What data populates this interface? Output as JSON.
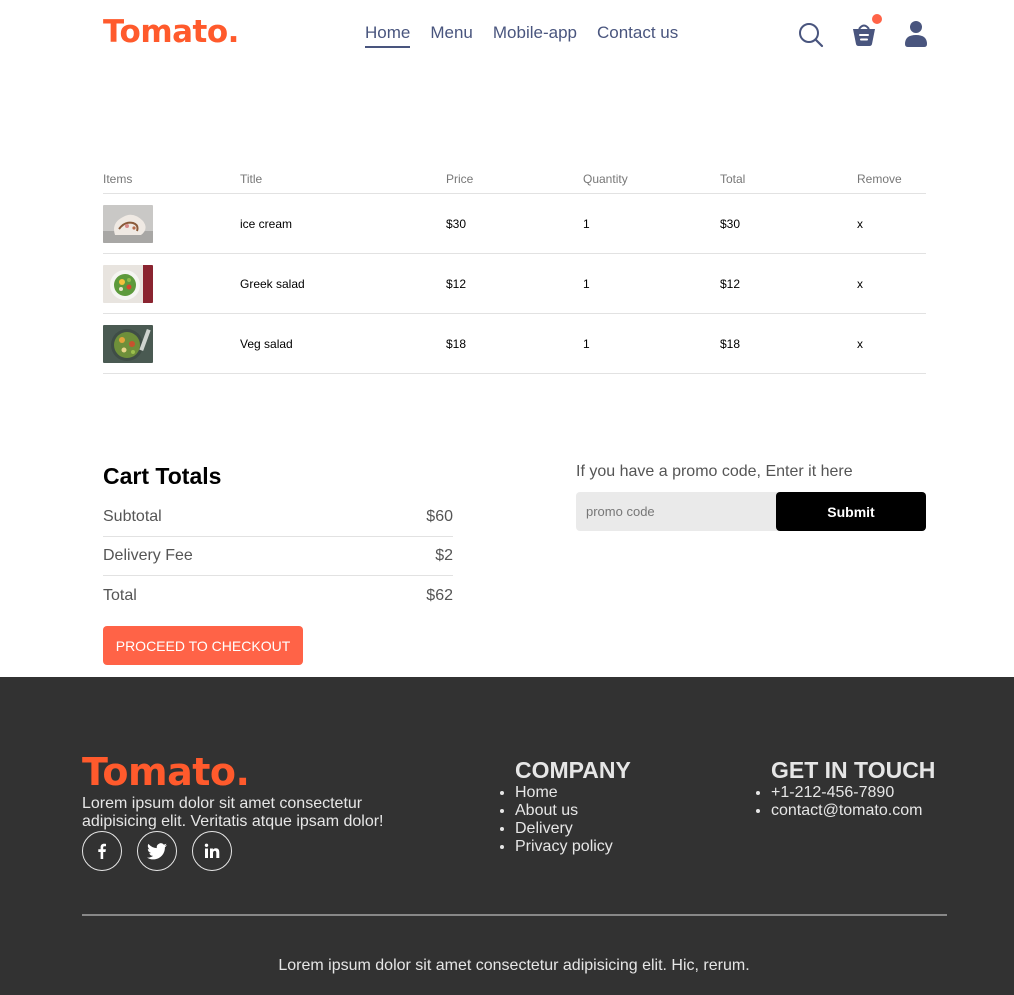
{
  "brand": {
    "logo": "Tomato.",
    "accent": "#ff6347",
    "logo_color": "#ff5a2c"
  },
  "nav": {
    "items": [
      {
        "label": "Home",
        "active": true
      },
      {
        "label": "Menu",
        "active": false
      },
      {
        "label": "Mobile-app",
        "active": false
      },
      {
        "label": "Contact us",
        "active": false
      }
    ],
    "icons": [
      "search-icon",
      "basket-icon",
      "profile-icon"
    ],
    "cart_has_items": true
  },
  "cart": {
    "headers": [
      "Items",
      "Title",
      "Price",
      "Quantity",
      "Total",
      "Remove"
    ],
    "rows": [
      {
        "image": "ice-cream-image",
        "title": "ice cream",
        "price": "$30",
        "quantity": "1",
        "total": "$30",
        "remove": "x"
      },
      {
        "image": "greek-salad-image",
        "title": "Greek salad",
        "price": "$12",
        "quantity": "1",
        "total": "$12",
        "remove": "x"
      },
      {
        "image": "veg-salad-image",
        "title": "Veg salad",
        "price": "$18",
        "quantity": "1",
        "total": "$18",
        "remove": "x"
      }
    ]
  },
  "totals": {
    "heading": "Cart Totals",
    "subtotal_label": "Subtotal",
    "subtotal": "$60",
    "delivery_label": "Delivery Fee",
    "delivery": "$2",
    "total_label": "Total",
    "total": "$62",
    "checkout_label": "PROCEED TO CHECKOUT"
  },
  "promo": {
    "text": "If you have a promo code, Enter it here",
    "placeholder": "promo code",
    "submit_label": "Submit"
  },
  "footer": {
    "logo": "Tomato.",
    "about": "Lorem ipsum dolor sit amet consectetur adipisicing elit. Veritatis atque ipsam dolor!",
    "socials": [
      "facebook-icon",
      "twitter-icon",
      "linkedin-icon"
    ],
    "company_heading": "COMPANY",
    "company_links": [
      "Home",
      "About us",
      "Delivery",
      "Privacy policy"
    ],
    "contact_heading": "GET IN TOUCH",
    "contact_items": [
      "+1-212-456-7890",
      "contact@tomato.com"
    ],
    "copyright": "Lorem ipsum dolor sit amet consectetur adipisicing elit. Hic, rerum."
  }
}
